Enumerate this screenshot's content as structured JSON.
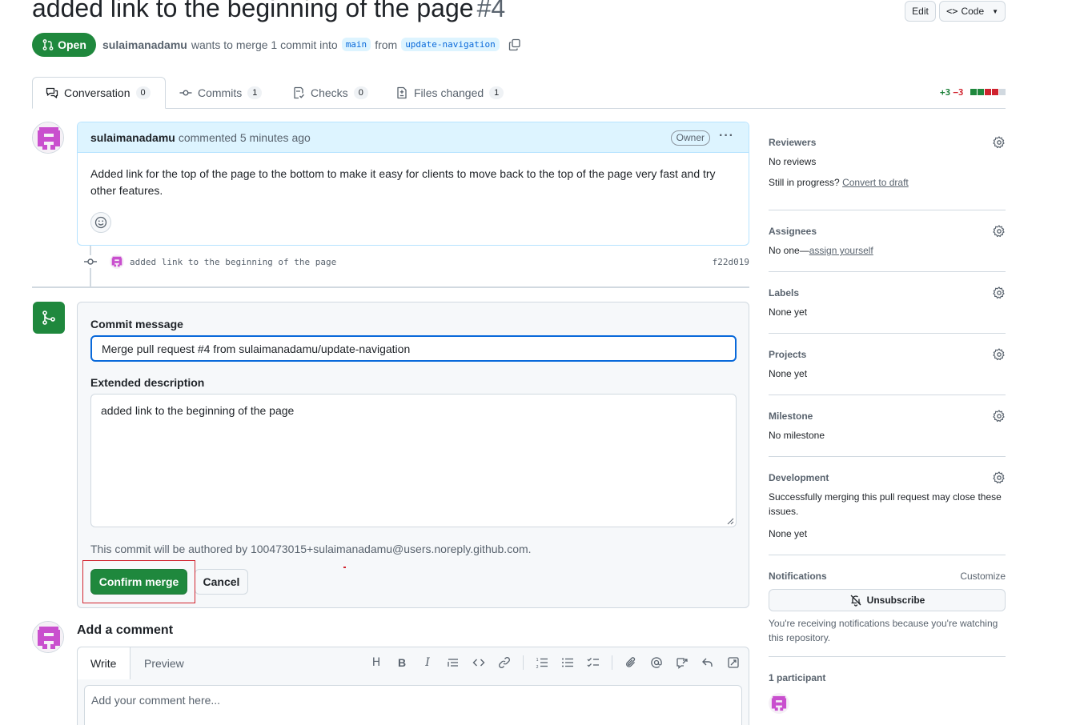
{
  "pr": {
    "title": "added link to the beginning of the page",
    "number": "#4",
    "state": "Open",
    "author": "sulaimanadamu",
    "merge_text": "wants to merge 1 commit into",
    "base_branch": "main",
    "from_text": "from",
    "head_branch": "update-navigation"
  },
  "header": {
    "edit_label": "Edit",
    "code_label": "Code"
  },
  "tabs": [
    {
      "label": "Conversation",
      "count": "0"
    },
    {
      "label": "Commits",
      "count": "1"
    },
    {
      "label": "Checks",
      "count": "0"
    },
    {
      "label": "Files changed",
      "count": "1"
    }
  ],
  "diffstat": {
    "additions": "+3",
    "deletions": "−3"
  },
  "comment": {
    "author": "sulaimanadamu",
    "action": "commented 5 minutes ago",
    "badge": "Owner",
    "body": "Added link for the top of the page to the bottom to make it easy for clients to move back to the top of the page very fast and try other features."
  },
  "commit": {
    "message": "added link to the beginning of the page",
    "sha": "f22d019"
  },
  "merge_form": {
    "commit_message_label": "Commit message",
    "commit_message_value": "Merge pull request #4 from sulaimanadamu/update-navigation",
    "extended_label": "Extended description",
    "extended_value": "added link to the beginning of the page",
    "author_note": "This commit will be authored by 100473015+sulaimanadamu@users.noreply.github.com.",
    "confirm_label": "Confirm merge",
    "cancel_label": "Cancel"
  },
  "add_comment": {
    "title": "Add a comment",
    "write_tab": "Write",
    "preview_tab": "Preview",
    "placeholder": "Add your comment here...",
    "heading_tool": "H",
    "bold_tool": "B",
    "italic_tool": "I"
  },
  "sidebar": {
    "reviewers": {
      "title": "Reviewers",
      "value": "No reviews",
      "progress_text": "Still in progress?",
      "progress_link": "Convert to draft"
    },
    "assignees": {
      "title": "Assignees",
      "value": "No one—",
      "link": "assign yourself"
    },
    "labels": {
      "title": "Labels",
      "value": "None yet"
    },
    "projects": {
      "title": "Projects",
      "value": "None yet"
    },
    "milestone": {
      "title": "Milestone",
      "value": "No milestone"
    },
    "development": {
      "title": "Development",
      "desc": "Successfully merging this pull request may close these issues.",
      "value": "None yet"
    },
    "notifications": {
      "title": "Notifications",
      "customize": "Customize",
      "unsubscribe": "Unsubscribe",
      "desc": "You're receiving notifications because you're watching this repository."
    },
    "participants": {
      "title": "1 participant"
    }
  },
  "colors": {
    "green": "#1f883d",
    "blue": "#0969da",
    "avatar": "#c94fce",
    "highlight": "#d1242f"
  }
}
